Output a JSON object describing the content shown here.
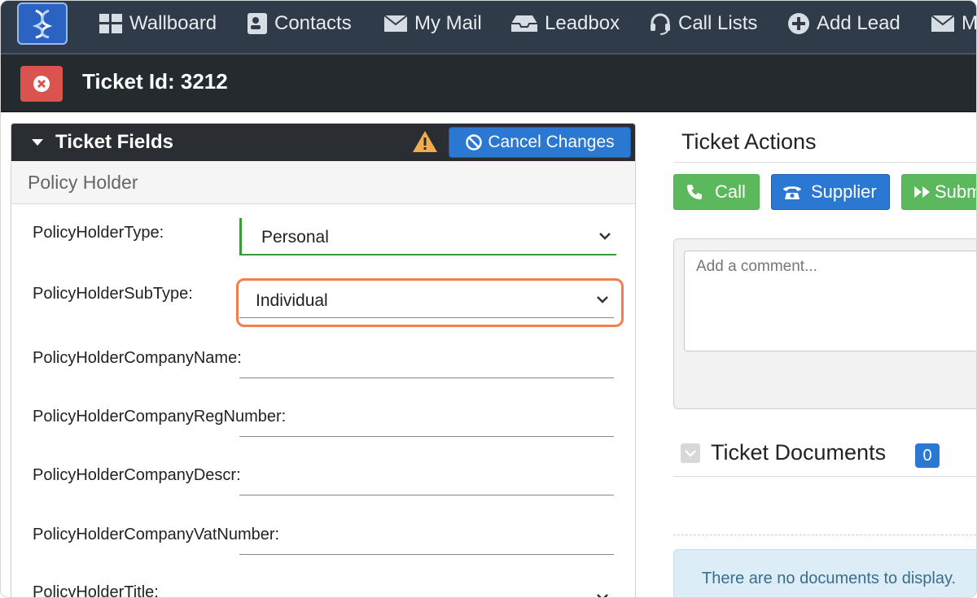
{
  "nav": {
    "items": [
      {
        "label": "Wallboard",
        "icon": "grid-icon"
      },
      {
        "label": "Contacts",
        "icon": "contact-card-icon"
      },
      {
        "label": "My Mail",
        "icon": "envelope-icon"
      },
      {
        "label": "Leadbox",
        "icon": "inbox-icon"
      },
      {
        "label": "Call Lists",
        "icon": "headset-icon"
      },
      {
        "label": "Add Lead",
        "icon": "plus-circle-icon"
      },
      {
        "label": "M",
        "icon": "envelope-icon"
      }
    ]
  },
  "ticket": {
    "title": "Ticket Id: 3212"
  },
  "fields_panel": {
    "title": "Ticket Fields",
    "cancel_label": "Cancel Changes",
    "section": "Policy Holder",
    "fields": [
      {
        "label": "PolicyHolderType:",
        "value": "Personal"
      },
      {
        "label": "PolicyHolderSubType:",
        "value": "Individual"
      },
      {
        "label": "PolicyHolderCompanyName:",
        "value": ""
      },
      {
        "label": "PolicyHolderCompanyRegNumber:",
        "value": ""
      },
      {
        "label": "PolicyHolderCompanyDescr:",
        "value": ""
      },
      {
        "label": "PolicyHolderCompanyVatNumber:",
        "value": ""
      },
      {
        "label": "PolicyHolderTitle:",
        "value": ""
      }
    ]
  },
  "actions": {
    "title": "Ticket Actions",
    "buttons": [
      {
        "label": "Call",
        "color": "#5cb85c"
      },
      {
        "label": "Supplier",
        "color": "#2a78d2"
      },
      {
        "label": "Subm",
        "color": "#5cb85c"
      }
    ],
    "comment_placeholder": "Add a comment..."
  },
  "documents": {
    "title": "Ticket Documents",
    "count": "0",
    "empty_text": "There are no documents to display."
  },
  "colors": {
    "nav_bg": "#2f3b48",
    "ticket_bar_bg": "#252a2f",
    "primary": "#2a78d2",
    "success": "#5cb85c",
    "danger": "#d9534f",
    "highlight": "#ef7f4e"
  }
}
